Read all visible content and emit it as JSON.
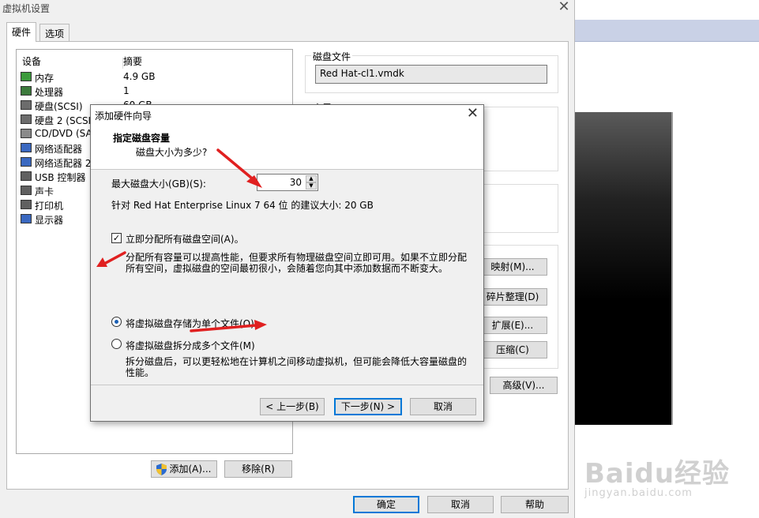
{
  "window": {
    "title": "虚拟机设置"
  },
  "tabs": [
    {
      "label": "硬件"
    },
    {
      "label": "选项"
    }
  ],
  "device_list": {
    "col_device": "设备",
    "col_summary": "摘要",
    "rows": [
      {
        "name": "内存",
        "summary": "4.9 GB"
      },
      {
        "name": "处理器",
        "summary": "1"
      },
      {
        "name": "硬盘(SCSI)",
        "summary": "60 GB"
      },
      {
        "name": "硬盘 2 (SCSI",
        "summary": ""
      },
      {
        "name": "CD/DVD (SAT",
        "summary": ""
      },
      {
        "name": "网络适配器",
        "summary": ""
      },
      {
        "name": "网络适配器 2",
        "summary": ""
      },
      {
        "name": "USB 控制器",
        "summary": ""
      },
      {
        "name": "声卡",
        "summary": ""
      },
      {
        "name": "打印机",
        "summary": ""
      },
      {
        "name": "显示器",
        "summary": ""
      }
    ]
  },
  "right_panel": {
    "disk_file_label": "磁盘文件",
    "disk_file_value": "Red Hat-cl1.vmdk",
    "capacity_label": "容里",
    "map_button": "映射(M)...",
    "defrag_button": "碎片整理(D)",
    "expand_button": "扩展(E)...",
    "compact_button": "压缩(C)",
    "advanced_button": "高级(V)..."
  },
  "bottom_buttons": {
    "add": "添加(A)...",
    "remove": "移除(R)",
    "ok": "确定",
    "cancel": "取消",
    "help": "帮助"
  },
  "dialog": {
    "title": "添加硬件向导",
    "heading": "指定磁盘容量",
    "subheading": "磁盘大小为多少?",
    "max_size_label": "最大磁盘大小(GB)(S):",
    "max_size_value": "30",
    "recommend": "针对 Red Hat Enterprise Linux 7 64 位 的建议大小: 20 GB",
    "allocate_label": "立即分配所有磁盘空间(A)。",
    "allocate_checked": true,
    "allocate_desc": "分配所有容量可以提高性能，但要求所有物理磁盘空间立即可用。如果不立即分配所有空间，虚拟磁盘的空间最初很小，会随着您向其中添加数据而不断变大。",
    "single_file_label": "将虚拟磁盘存储为单个文件(O)",
    "split_label": "将虚拟磁盘拆分成多个文件(M)",
    "split_desc": "拆分磁盘后，可以更轻松地在计算机之间移动虚拟机，但可能会降低大容量磁盘的性能。",
    "selected_option": "single",
    "back_button": "< 上一步(B)",
    "next_button": "下一步(N) >",
    "cancel_button": "取消"
  },
  "watermark": {
    "main": "Baidu经验",
    "sub": "jingyan.baidu.com"
  },
  "colors": {
    "annotation_arrow": "#e02020",
    "selection_accent": "#0078d7"
  }
}
